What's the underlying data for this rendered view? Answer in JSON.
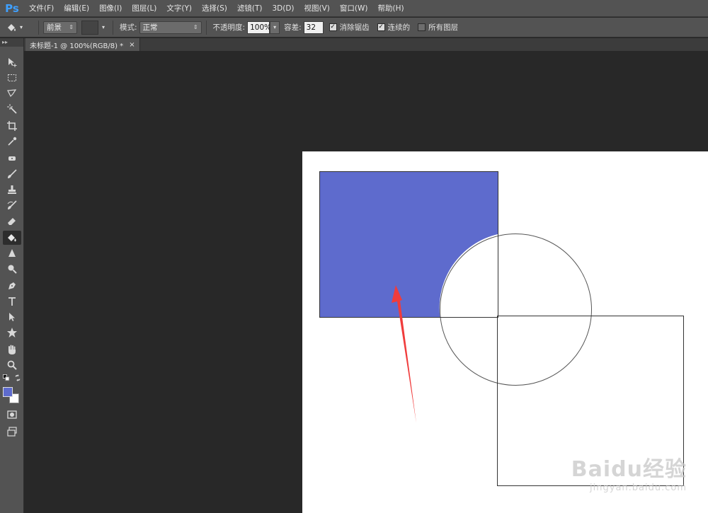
{
  "app": {
    "logo": "Ps"
  },
  "menu": [
    "文件(F)",
    "编辑(E)",
    "图像(I)",
    "图层(L)",
    "文字(Y)",
    "选择(S)",
    "滤镜(T)",
    "3D(D)",
    "视图(V)",
    "窗口(W)",
    "帮助(H)"
  ],
  "options": {
    "fill_source": "前景",
    "mode_label": "模式:",
    "mode_value": "正常",
    "opacity_label": "不透明度:",
    "opacity_value": "100%",
    "tolerance_label": "容差:",
    "tolerance_value": "32",
    "antialias_label": "消除锯齿",
    "antialias_checked": true,
    "contiguous_label": "连续的",
    "contiguous_checked": true,
    "all_layers_label": "所有图层",
    "all_layers_checked": false
  },
  "document_tab": {
    "title": "未标题-1 @ 100%(RGB/8) *",
    "close": "×"
  },
  "colors": {
    "foreground": "#5e6bcd",
    "background": "#ffffff",
    "fill": "#5e6bcd",
    "annotation_arrow": "#f03c3c"
  },
  "tools": [
    "move-icon",
    "marquee-icon",
    "lasso-icon",
    "magic-wand-icon",
    "crop-icon",
    "eyedropper-icon",
    "healing-icon",
    "brush-icon",
    "stamp-icon",
    "history-brush-icon",
    "eraser-icon",
    "paint-bucket-icon",
    "blur-icon",
    "dodge-icon",
    "pen-icon",
    "type-icon",
    "path-select-icon",
    "shape-icon",
    "hand-icon",
    "zoom-icon"
  ],
  "active_tool": "paint-bucket-icon",
  "watermark": {
    "brand": "Baidu经验",
    "url": "jingyan.baidu.com"
  }
}
